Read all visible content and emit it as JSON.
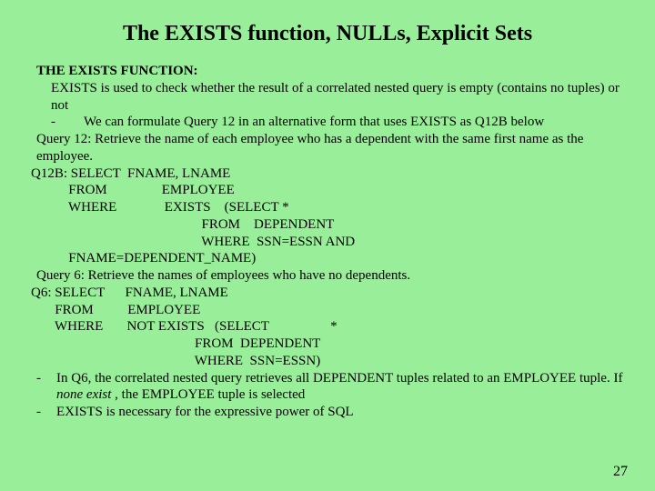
{
  "title": "The EXISTS function, NULLs, Explicit Sets",
  "heading": "THE EXISTS FUNCTION:",
  "intro1": "EXISTS is used to check whether the result of a correlated nested query is empty (contains no tuples) or not",
  "bullet1_mark": "-",
  "bullet1_text": "We can formulate Query 12 in an alternative form that uses EXISTS as Q12B below",
  "query12_desc": "Query 12: Retrieve the name of each employee who has a dependent with the same first name as the employee.",
  "q12b_l1": "Q12B: SELECT  FNAME, LNAME",
  "q12b_l2": "           FROM                EMPLOYEE",
  "q12b_l3": "           WHERE              EXISTS    (SELECT *",
  "q12b_l4": "                                                  FROM    DEPENDENT",
  "q12b_l5": "                                                  WHERE  SSN=ESSN AND",
  "q12b_l6": "           FNAME=DEPENDENT_NAME)",
  "query6_desc": "Query 6: Retrieve the names of employees who have no dependents.",
  "q6_l1": "Q6: SELECT      FNAME, LNAME",
  "q6_l2": "       FROM          EMPLOYEE",
  "q6_l3": "       WHERE       NOT EXISTS   (SELECT                  *",
  "q6_l4": "                                                FROM  DEPENDENT",
  "q6_l5": "                                                WHERE  SSN=ESSN)",
  "note1_mark": "-",
  "note1_a": "In Q6, the correlated nested query retrieves all DEPENDENT tuples related to an EMPLOYEE tuple. If ",
  "note1_italic": "none exist",
  "note1_b": " , the EMPLOYEE tuple is selected",
  "note2_mark": "-",
  "note2_text": "EXISTS is necessary for the expressive power of SQL",
  "page_number": "27"
}
